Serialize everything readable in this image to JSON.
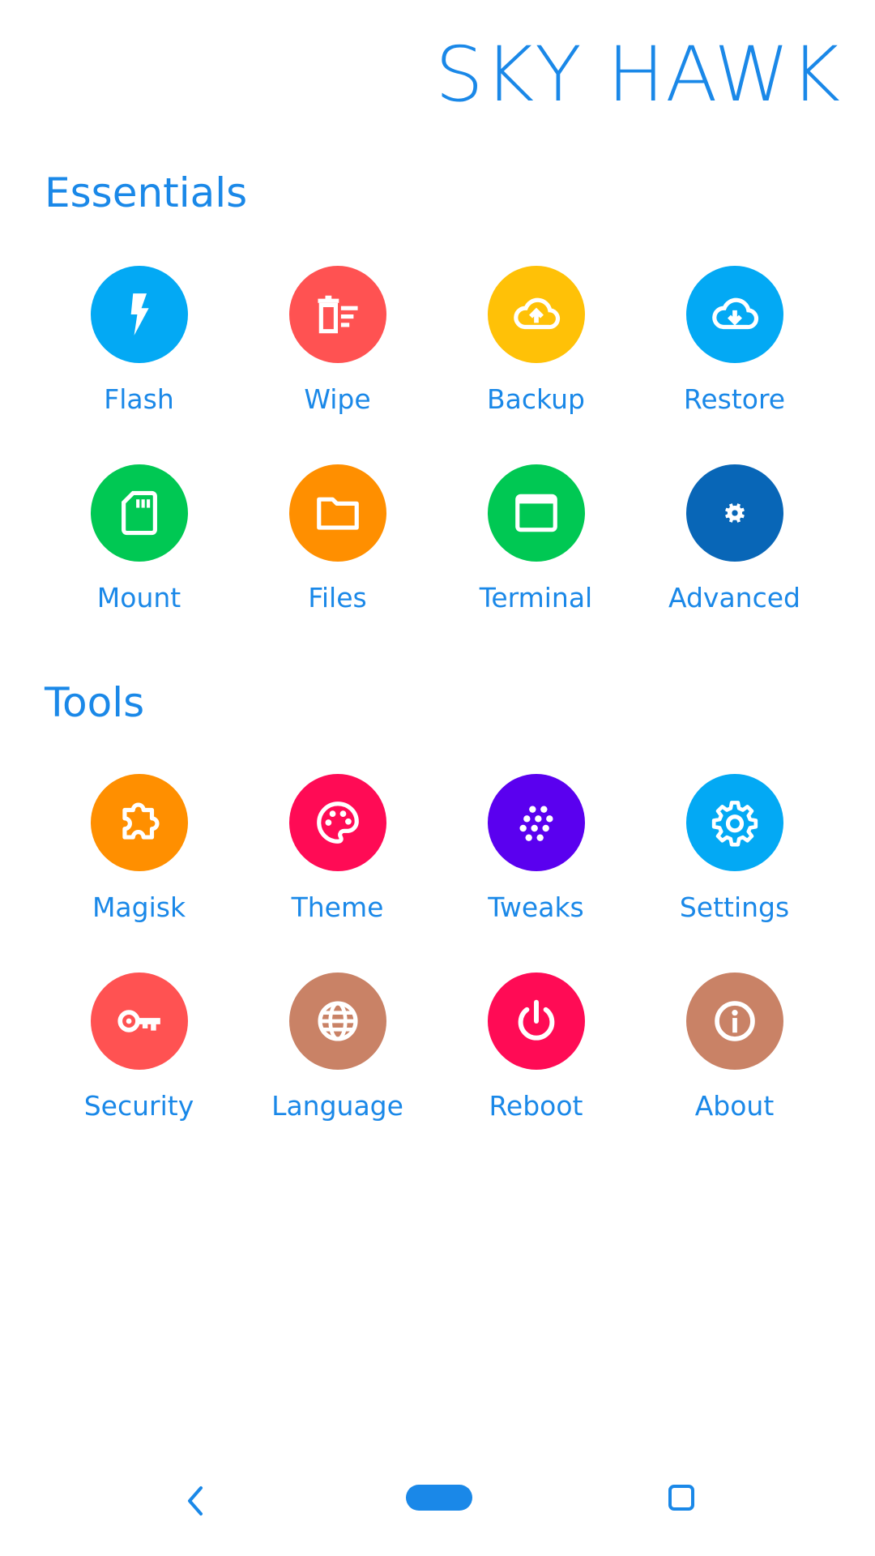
{
  "header": {
    "title": "SKY HAWK"
  },
  "colors": {
    "accent": "#1a88e8"
  },
  "essentials": {
    "title": "Essentials",
    "items": [
      {
        "label": "Flash",
        "icon": "lightning-icon",
        "color": "#03a9f4"
      },
      {
        "label": "Wipe",
        "icon": "trash-list-icon",
        "color": "#ff5252"
      },
      {
        "label": "Backup",
        "icon": "cloud-upload-icon",
        "color": "#ffc107"
      },
      {
        "label": "Restore",
        "icon": "cloud-download-icon",
        "color": "#03a9f4"
      },
      {
        "label": "Mount",
        "icon": "sd-card-icon",
        "color": "#00c853"
      },
      {
        "label": "Files",
        "icon": "folder-icon",
        "color": "#ff8f00"
      },
      {
        "label": "Terminal",
        "icon": "terminal-window-icon",
        "color": "#00c853"
      },
      {
        "label": "Advanced",
        "icon": "gear-icon",
        "color": "#0866b7"
      }
    ]
  },
  "tools": {
    "title": "Tools",
    "items": [
      {
        "label": "Magisk",
        "icon": "puzzle-icon",
        "color": "#ff8f00"
      },
      {
        "label": "Theme",
        "icon": "palette-icon",
        "color": "#ff0b55"
      },
      {
        "label": "Tweaks",
        "icon": "dots-pattern-icon",
        "color": "#5a00ef"
      },
      {
        "label": "Settings",
        "icon": "settings-gear-icon",
        "color": "#03a9f4"
      },
      {
        "label": "Security",
        "icon": "key-icon",
        "color": "#ff5252"
      },
      {
        "label": "Language",
        "icon": "globe-icon",
        "color": "#c98266"
      },
      {
        "label": "Reboot",
        "icon": "power-icon",
        "color": "#ff0b55"
      },
      {
        "label": "About",
        "icon": "info-icon",
        "color": "#c98266"
      }
    ]
  },
  "navbar": {
    "back_icon": "back-chevron-icon",
    "home_icon": "home-pill-icon",
    "recent_icon": "recent-apps-icon"
  }
}
